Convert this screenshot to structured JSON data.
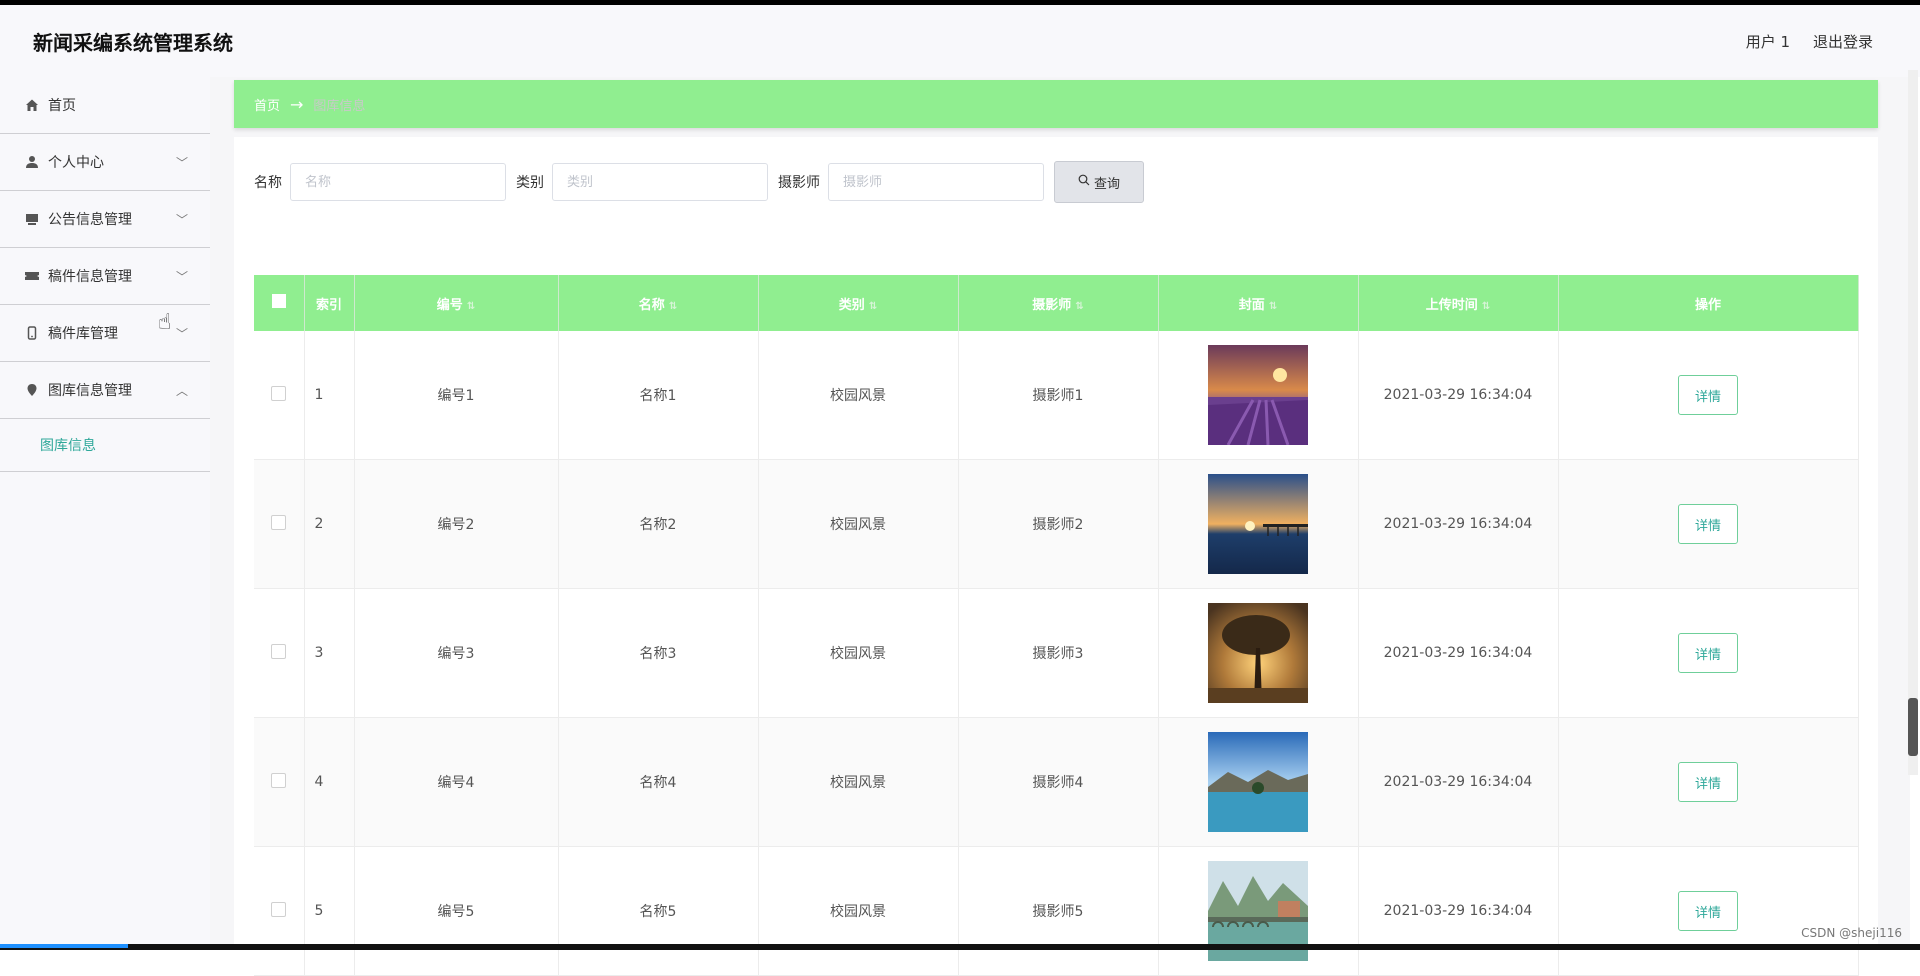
{
  "app": {
    "title": "新闻采编系统管理系统"
  },
  "header": {
    "user": "用户 1",
    "logout": "退出登录"
  },
  "sidebar": {
    "items": [
      {
        "label": "首页",
        "icon": "home-icon",
        "has_arrow": false
      },
      {
        "label": "个人中心",
        "icon": "user-icon",
        "has_arrow": true
      },
      {
        "label": "公告信息管理",
        "icon": "notice-icon",
        "has_arrow": true
      },
      {
        "label": "稿件信息管理",
        "icon": "ticket-icon",
        "has_arrow": true
      },
      {
        "label": "稿件库管理",
        "icon": "phone-icon",
        "has_arrow": true
      },
      {
        "label": "图库信息管理",
        "icon": "location-icon",
        "has_arrow": true,
        "expanded": true
      }
    ],
    "submenu": {
      "label": "图库信息"
    }
  },
  "breadcrumb": {
    "home": "首页",
    "arrow": "→",
    "current": "图库信息"
  },
  "search": {
    "name_label": "名称",
    "name_placeholder": "名称",
    "category_label": "类别",
    "category_placeholder": "类别",
    "photographer_label": "摄影师",
    "photographer_placeholder": "摄影师",
    "button_label": "查询",
    "button_icon": "search-icon"
  },
  "table": {
    "headers": [
      "索引",
      "编号",
      "名称",
      "类别",
      "摄影师",
      "封面",
      "上传时间",
      "操作"
    ],
    "detail_label": "详情",
    "rows": [
      {
        "index": "1",
        "code": "编号1",
        "name": "名称1",
        "category": "校园风景",
        "photographer": "摄影师1",
        "upload_time": "2021-03-29 16:34:04"
      },
      {
        "index": "2",
        "code": "编号2",
        "name": "名称2",
        "category": "校园风景",
        "photographer": "摄影师2",
        "upload_time": "2021-03-29 16:34:04"
      },
      {
        "index": "3",
        "code": "编号3",
        "name": "名称3",
        "category": "校园风景",
        "photographer": "摄影师3",
        "upload_time": "2021-03-29 16:34:04"
      },
      {
        "index": "4",
        "code": "编号4",
        "name": "名称4",
        "category": "校园风景",
        "photographer": "摄影师4",
        "upload_time": "2021-03-29 16:34:04"
      },
      {
        "index": "5",
        "code": "编号5",
        "name": "名称5",
        "category": "校园风景",
        "photographer": "摄影师5",
        "upload_time": "2021-03-29 16:34:04"
      }
    ]
  },
  "colors": {
    "accent": "#90ee90",
    "link": "#2fa89a",
    "detail_border": "#6fcf9a"
  },
  "watermark": "CSDN @sheji116"
}
